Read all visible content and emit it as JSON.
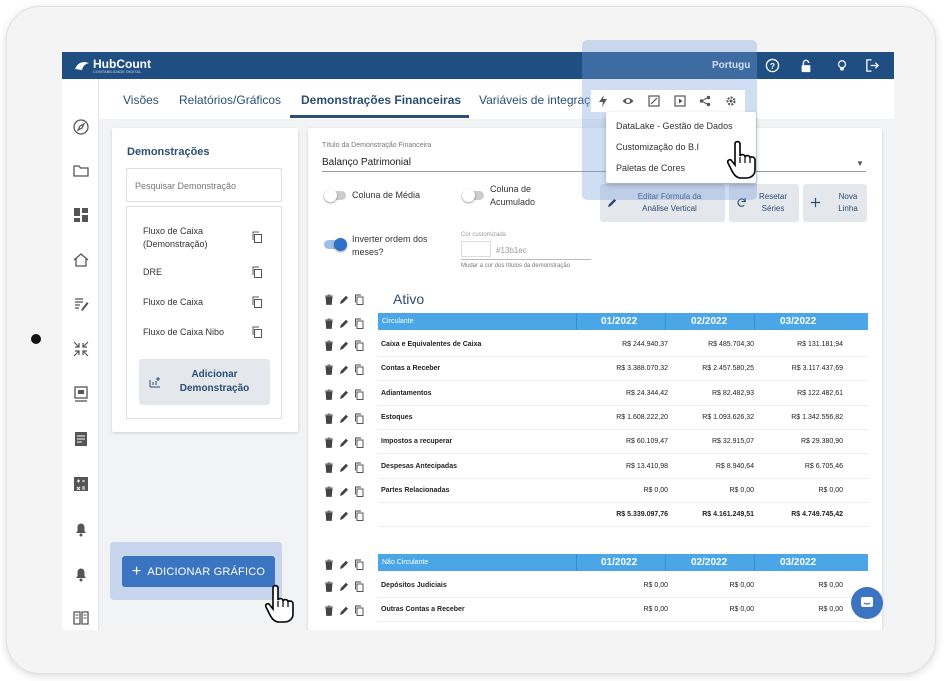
{
  "header": {
    "logo_text": "HubCount",
    "logo_sub": "CONTABILIDADE DIGITAL",
    "language": "Portugu"
  },
  "tabs": [
    {
      "label": "Visões"
    },
    {
      "label": "Relatórios/Gráficos"
    },
    {
      "label": "Demonstrações Financeiras"
    },
    {
      "label": "Variáveis de integraç"
    }
  ],
  "left_panel": {
    "title": "Demonstrações",
    "search_placeholder": "Pesquisar Demonstração",
    "items": [
      {
        "label": "Fluxo de Caixa (Demonstração)"
      },
      {
        "label": "DRE"
      },
      {
        "label": "Fluxo de Caixa"
      },
      {
        "label": "Fluxo de Caixa Nibo"
      }
    ],
    "add_label": "Adicionar Demonstração"
  },
  "add_graph_label": "ADICIONAR GRÁFICO",
  "main": {
    "title_label": "Título da Demonstração Financeira",
    "title_value": "Balanço Patrimonial",
    "toggles": {
      "media": "Coluna de Média",
      "acumulado": "Coluna de Acumulado",
      "inverter": "Inverter ordem dos meses?"
    },
    "buttons": {
      "editar": "Editar Fórmula da Análise Vertical",
      "resetar": "Resetar Séries",
      "nova": "Nova Linha"
    },
    "custom_color": {
      "label": "Cor customizada",
      "value": "#13b1ec",
      "help": "Mudar a cor dos títulos da demonstração"
    },
    "section_title": "Ativo",
    "months": [
      "01/2022",
      "02/2022",
      "03/2022"
    ],
    "circulante": {
      "header": "Circulante",
      "rows": [
        {
          "label": "Caixa e Equivalentes de Caixa",
          "values": [
            "R$ 244.940,37",
            "R$ 485.704,30",
            "R$ 131.181,94"
          ]
        },
        {
          "label": "Contas a Receber",
          "values": [
            "R$ 3.388.070,32",
            "R$ 2.457.580,25",
            "R$ 3.117.437,69"
          ]
        },
        {
          "label": "Adiantamentos",
          "values": [
            "R$ 24.344,42",
            "R$ 82.482,93",
            "R$ 122.482,61"
          ]
        },
        {
          "label": "Estoques",
          "values": [
            "R$ 1.608.222,20",
            "R$ 1.093.626,32",
            "R$ 1.342.556,82"
          ]
        },
        {
          "label": "Impostos a recuperar",
          "values": [
            "R$ 60.109,47",
            "R$ 32.915,07",
            "R$ 29.380,90"
          ]
        },
        {
          "label": "Despesas Antecipadas",
          "values": [
            "R$ 13.410,98",
            "R$ 8.940,64",
            "R$ 6.705,46"
          ]
        },
        {
          "label": "Partes Relacionadas",
          "values": [
            "R$ 0,00",
            "R$ 0,00",
            "R$ 0,00"
          ]
        },
        {
          "label": "",
          "values": [
            "R$ 5.339.097,76",
            "R$ 4.161.249,51",
            "R$ 4.749.745,42"
          ]
        }
      ]
    },
    "nao_circulante": {
      "header": "Não Circulante",
      "rows": [
        {
          "label": "Depósitos Judiciais",
          "values": [
            "R$ 0,00",
            "R$ 0,00",
            "R$ 0,00"
          ]
        },
        {
          "label": "Outras Contas a Receber",
          "values": [
            "R$ 0,00",
            "R$ 0,00",
            "R$ 0,00"
          ]
        }
      ]
    }
  },
  "popup_menu": {
    "items": [
      {
        "label": "DataLake - Gestão de Dados"
      },
      {
        "label": "Customização do B.I"
      },
      {
        "label": "Paletas de Cores"
      }
    ]
  },
  "colors": {
    "header_bg": "#1f4f82",
    "table_header": "#4aa6e6",
    "primary": "#3b74c0",
    "text_accent": "#2b4e74"
  }
}
